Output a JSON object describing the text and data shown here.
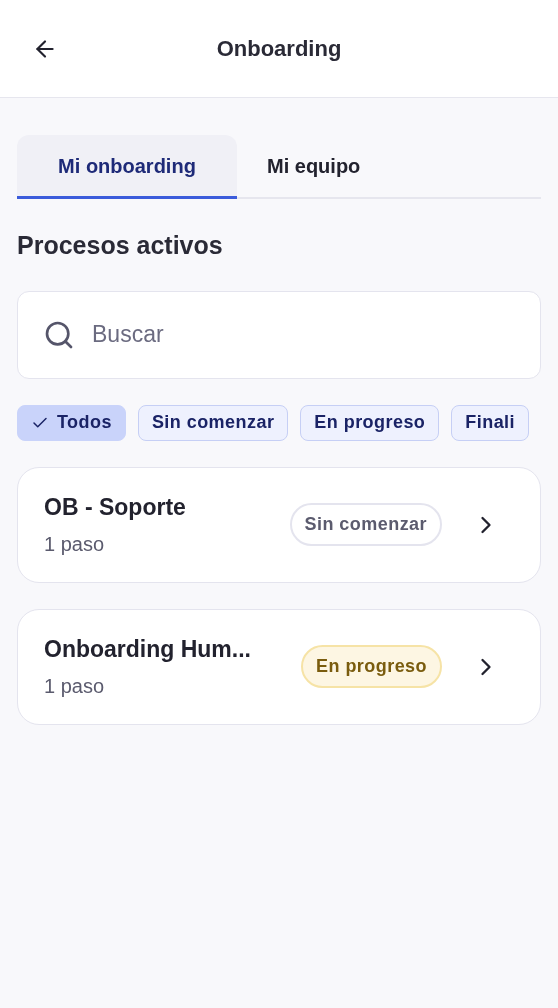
{
  "header": {
    "title": "Onboarding"
  },
  "tabs": [
    {
      "label": "Mi onboarding",
      "selected": true
    },
    {
      "label": "Mi equipo",
      "selected": false
    }
  ],
  "section_title": "Procesos activos",
  "search": {
    "placeholder": "Buscar"
  },
  "filters": [
    {
      "label": "Todos",
      "selected": true
    },
    {
      "label": "Sin comenzar",
      "selected": false
    },
    {
      "label": "En progreso",
      "selected": false
    },
    {
      "label": "Finali",
      "selected": false
    }
  ],
  "processes": [
    {
      "name": "OB - Soporte",
      "steps": "1 paso",
      "status": {
        "kind": "not_started",
        "label": "Sin comenzar"
      }
    },
    {
      "name": "Onboarding Hum...",
      "steps": "1 paso",
      "status": {
        "kind": "in_progress",
        "label": "En progreso"
      }
    }
  ]
}
